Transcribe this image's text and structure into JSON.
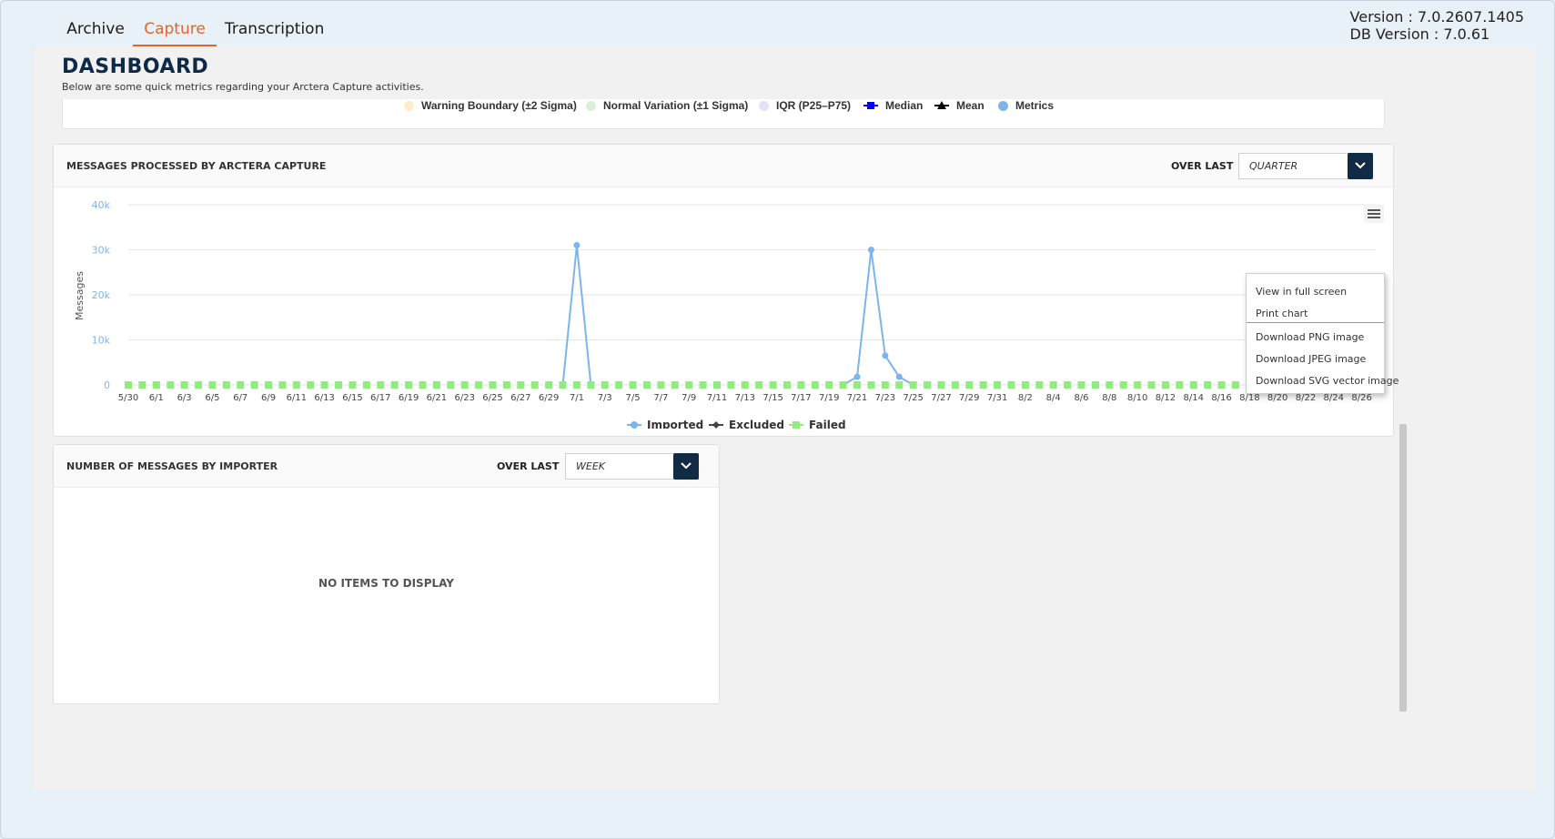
{
  "tabs": [
    {
      "label": "Archive"
    },
    {
      "label": "Capture"
    },
    {
      "label": "Transcription"
    }
  ],
  "version": {
    "app": "Version : 7.0.2607.1405",
    "db": "DB Version : 7.0.61"
  },
  "dashboard": {
    "title": "DASHBOARD",
    "subtitle": "Below are some quick metrics regarding your Arctera Capture activities."
  },
  "top_legend": {
    "items": [
      {
        "label": "Warning Boundary (±2 Sigma)",
        "color": "#fdeccd",
        "icon": "circle"
      },
      {
        "label": "Normal Variation (±1 Sigma)",
        "color": "#d7efdb",
        "icon": "circle"
      },
      {
        "label": "IQR (P25–P75)",
        "color": "#e3e3f7",
        "icon": "circle"
      },
      {
        "label": "Median",
        "color": "#0000ff",
        "icon": "square-line"
      },
      {
        "label": "Mean",
        "color": "#000000",
        "icon": "triangle-line"
      },
      {
        "label": "Metrics",
        "color": "#7cb5ec",
        "icon": "circle"
      }
    ]
  },
  "messages_card": {
    "title": "MESSAGES PROCESSED BY ARCTERA CAPTURE",
    "over_last_label": "OVER LAST",
    "period_value": "QUARTER",
    "menu_icon": "hamburger-icon",
    "context_menu": [
      "View in full screen",
      "Print chart",
      "Download PNG image",
      "Download JPEG image",
      "Download SVG vector image"
    ]
  },
  "importer_card": {
    "title": "NUMBER OF MESSAGES BY IMPORTER",
    "over_last_label": "OVER LAST",
    "period_value": "WEEK",
    "empty_text": "NO ITEMS TO DISPLAY"
  },
  "chart_data": {
    "type": "line",
    "ylabel": "Messages",
    "ylim": [
      0,
      40000
    ],
    "yticks": [
      "0",
      "10k",
      "20k",
      "30k",
      "40k"
    ],
    "ytick_values": [
      0,
      10000,
      20000,
      30000,
      40000
    ],
    "xtick_labels": [
      "5/30",
      "6/1",
      "6/3",
      "6/5",
      "6/7",
      "6/9",
      "6/11",
      "6/13",
      "6/15",
      "6/17",
      "6/19",
      "6/21",
      "6/23",
      "6/25",
      "6/27",
      "6/29",
      "7/1",
      "7/3",
      "7/5",
      "7/7",
      "7/9",
      "7/11",
      "7/13",
      "7/15",
      "7/17",
      "7/19",
      "7/21",
      "7/23",
      "7/25",
      "7/27",
      "7/29",
      "7/31",
      "8/2",
      "8/4",
      "8/6",
      "8/8",
      "8/10",
      "8/12",
      "8/14",
      "8/16",
      "8/18",
      "8/20",
      "8/22",
      "8/24",
      "8/26"
    ],
    "n_points": 90,
    "legend_position": "bottom-center",
    "series": [
      {
        "name": "Imported",
        "color": "#7cb5ec",
        "marker": "circle",
        "nonzero": [
          {
            "date": "7/1",
            "value": 31000
          },
          {
            "date": "7/21",
            "value": 1800
          },
          {
            "date": "7/22",
            "value": 30000
          },
          {
            "date": "7/23",
            "value": 6500
          },
          {
            "date": "7/24",
            "value": 1800
          }
        ]
      },
      {
        "name": "Excluded",
        "color": "#434348",
        "marker": "diamond",
        "nonzero": []
      },
      {
        "name": "Failed",
        "color": "#90ed7d",
        "marker": "square",
        "nonzero": []
      }
    ]
  }
}
